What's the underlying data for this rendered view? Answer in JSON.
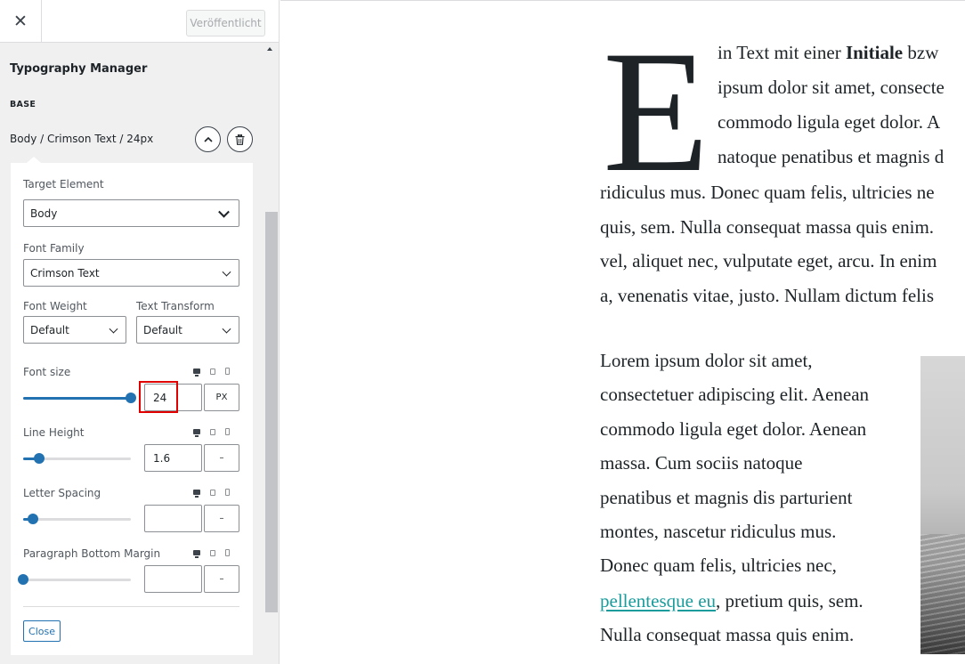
{
  "topbar": {
    "close_icon": "close-icon",
    "publish_label": "Veröffentlicht"
  },
  "sidebar": {
    "section_title": "Typography Manager",
    "base_label": "BASE",
    "rule_title": "Body / Crimson Text / 24px",
    "collapse_icon": "chevron-up-icon",
    "delete_icon": "trash-icon"
  },
  "panel": {
    "target_element": {
      "label": "Target Element",
      "value": "Body"
    },
    "font_family": {
      "label": "Font Family",
      "value": "Crimson Text"
    },
    "font_weight": {
      "label": "Font Weight",
      "value": "Default"
    },
    "text_transform": {
      "label": "Text Transform",
      "value": "Default"
    },
    "font_size": {
      "label": "Font size",
      "value": "24",
      "unit": "PX",
      "slider_level": 1.0
    },
    "line_height": {
      "label": "Line Height",
      "value": "1.6",
      "unit": "–",
      "slider_level": 0.15
    },
    "letter_spacing": {
      "label": "Letter Spacing",
      "value": "",
      "unit": "–",
      "slider_level": 0.09
    },
    "paragraph_bottom_margin": {
      "label": "Paragraph Bottom Margin",
      "value": "",
      "unit": "–",
      "slider_level": 0.0
    },
    "close_label": "Close",
    "device_icons": [
      "desktop-icon",
      "tablet-icon",
      "mobile-icon"
    ]
  },
  "colors": {
    "accent": "#2271b1",
    "highlight": "#e00000",
    "link": "#1a9c9c"
  },
  "preview": {
    "drop_cap": "E",
    "dropcap_lines": [
      {
        "pre": "in Text mit einer ",
        "bold": "Initiale",
        "post": " bzw"
      },
      {
        "pre": "ipsum dolor sit amet, consecte",
        "bold": "",
        "post": ""
      },
      {
        "pre": "commodo ligula eget dolor. A",
        "bold": "",
        "post": ""
      },
      {
        "pre": "natoque penatibus et magnis d",
        "bold": "",
        "post": ""
      }
    ],
    "full_lines": [
      "ridiculus mus. Donec quam felis, ultricies ne",
      "quis, sem. Nulla consequat massa quis enim.",
      "vel, aliquet nec, vulputate eget, arcu. In enim",
      "a, venenatis vitae, justo. Nullam dictum felis"
    ],
    "para2_lines": [
      "Lorem ipsum dolor sit amet,",
      "consectetuer adipiscing elit. Aenean",
      "commodo ligula eget dolor. Aenean",
      "massa. Cum sociis natoque",
      "penatibus et magnis dis parturient",
      "montes, nascetur ridiculus mus.",
      "Donec quam felis, ultricies nec,"
    ],
    "link_text": "pellentesque eu",
    "link_line_rest": ", pretium quis, sem.",
    "last_line": "Nulla consequat massa quis enim."
  }
}
